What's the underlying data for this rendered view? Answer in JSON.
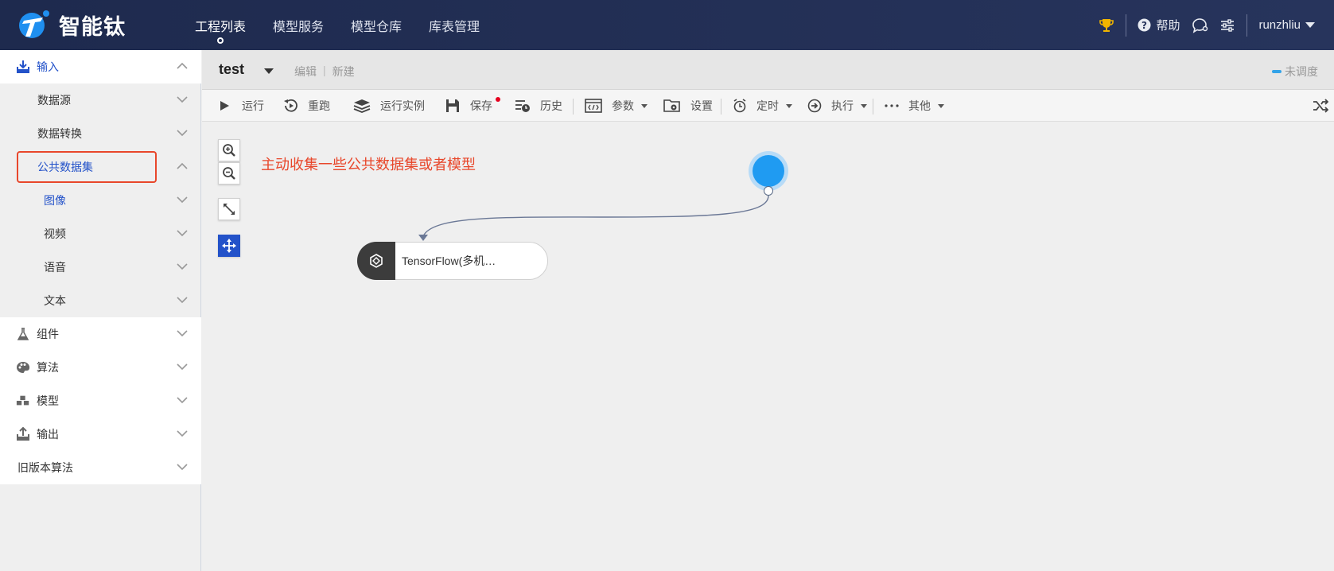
{
  "header": {
    "brand": "智能钛",
    "nav": [
      {
        "label": "工程列表"
      },
      {
        "label": "模型服务"
      },
      {
        "label": "模型仓库"
      },
      {
        "label": "库表管理"
      }
    ],
    "help_label": "帮助",
    "username": "runzhliu"
  },
  "sidebar": {
    "items": [
      {
        "label": "输入"
      },
      {
        "label": "数据源"
      },
      {
        "label": "数据转换"
      },
      {
        "label": "公共数据集"
      },
      {
        "label": "图像"
      },
      {
        "label": "视频"
      },
      {
        "label": "语音"
      },
      {
        "label": "文本"
      },
      {
        "label": "组件"
      },
      {
        "label": "算法"
      },
      {
        "label": "模型"
      },
      {
        "label": "输出"
      },
      {
        "label": "旧版本算法"
      }
    ]
  },
  "project": {
    "name": "test",
    "edit_label": "编辑",
    "divider": "|",
    "new_label": "新建",
    "schedule_status": "未调度"
  },
  "toolbar": {
    "run": "运行",
    "rerun": "重跑",
    "instances": "运行实例",
    "save": "保存",
    "history": "历史",
    "params": "参数",
    "settings": "设置",
    "timer": "定时",
    "execute": "执行",
    "other": "其他"
  },
  "canvas": {
    "annotation": "主动收集一些公共数据集或者模型",
    "node_label": "TensorFlow(多机…"
  },
  "colors": {
    "header_bg": "#1e2a4e",
    "accent_blue": "#2352c9",
    "annotation_red": "#e8472b",
    "start_node": "#1f9bf2"
  }
}
